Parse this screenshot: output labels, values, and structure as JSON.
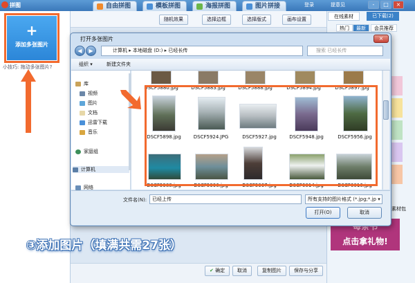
{
  "app": {
    "title": "拼图",
    "tabs": [
      "自由拼图",
      "模板拼图",
      "海报拼图",
      "图片拼接"
    ],
    "top_right": [
      "登录",
      "提意见"
    ],
    "win_controls": [
      "-",
      "□",
      "×"
    ]
  },
  "left": {
    "add_plus": "+",
    "add_label": "添加多张图片",
    "hint": "小技巧: 拖动多张图片?"
  },
  "toolbar": {
    "random": "随机效果",
    "border": "选择边框",
    "layout": "选择版式",
    "canvas": "画布设置"
  },
  "right": {
    "tabs": [
      "在线素材",
      "已下载(2)"
    ],
    "subtabs": [
      "热门",
      "最新",
      "会员推荐"
    ],
    "pack_label": "素材包",
    "promo": [
      "每条书",
      "点击拿礼物!"
    ]
  },
  "bottom": {
    "confirm": "确定",
    "cancel": "取消",
    "copy": "复制图片",
    "save": "保存与分享"
  },
  "caption": "③添加图片（填满共需27张）",
  "dialog": {
    "title": "打开多张图片",
    "close": "×",
    "address": [
      "计算机",
      "本地磁盘 (D:)",
      "已经长传"
    ],
    "search_placeholder": "搜索 已经长传",
    "organize": "组织 ▾",
    "new_folder": "新建文件夹",
    "nav": [
      "库",
      "视频",
      "图片",
      "文档",
      "迅雷下载",
      "音乐",
      "家庭组",
      "计算机",
      "网络"
    ],
    "top_row_files": [
      "DSCF5880.jpg",
      "DSCF5883.jpg",
      "DSCF5888.jpg",
      "DSCF5894.jpg",
      "DSCF5897.jpg"
    ],
    "row1_files": [
      "DSCF5898.jpg",
      "DSCF5924.JPG",
      "DSCF5927.jpg",
      "DSCF5948.jpg",
      "DSCF5956.jpg"
    ],
    "row2_files": [
      "DSCF5988.jpg",
      "DSCF5996.jpg",
      "DSCF5997.jpg",
      "DSCF6014.jpg",
      "DSCF6016.jpg"
    ],
    "filename_label": "文件名(N):",
    "filename_value": "已经上传",
    "filetype": "所有支持的图片格式 (*.jpg;*.jp ▾",
    "open": "打开(O)",
    "cancel": "取消"
  },
  "colors": {
    "highlight": "#f26a2e",
    "accent": "#2c86d8"
  }
}
